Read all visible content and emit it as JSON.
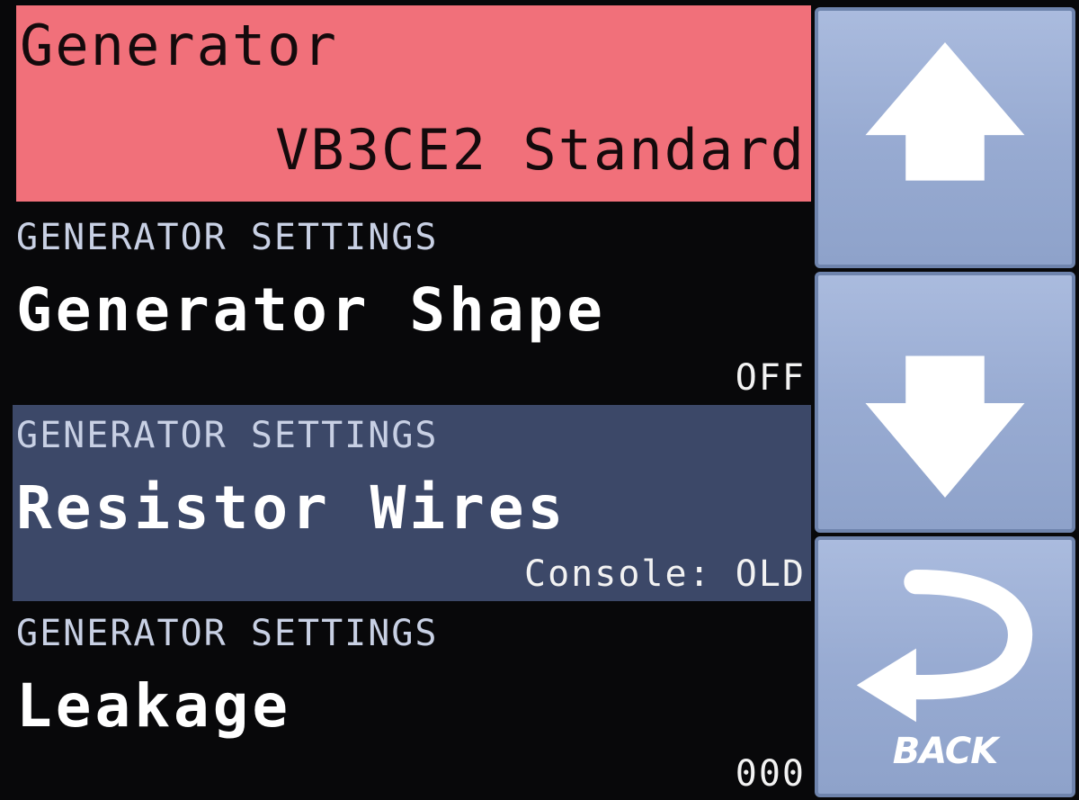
{
  "header": {
    "title": "Generator",
    "value": "VB3CE2 Standard"
  },
  "rows": [
    {
      "category": "GENERATOR SETTINGS",
      "name": "Generator Shape",
      "value": "OFF",
      "selected": false
    },
    {
      "category": "GENERATOR SETTINGS",
      "name": "Resistor Wires",
      "value": "Console: OLD",
      "selected": true
    },
    {
      "category": "GENERATOR SETTINGS",
      "name": "Leakage",
      "value": "000",
      "selected": false
    }
  ],
  "buttons": {
    "up_icon": "arrow-up-icon",
    "down_icon": "arrow-down-icon",
    "back_icon": "back-arrow-icon",
    "back_label": "BACK"
  },
  "colors": {
    "header_bg": "#f1707a",
    "selected_row_bg": "#3c4868",
    "button_bg": "#9fb1d8",
    "background": "#08080a"
  }
}
